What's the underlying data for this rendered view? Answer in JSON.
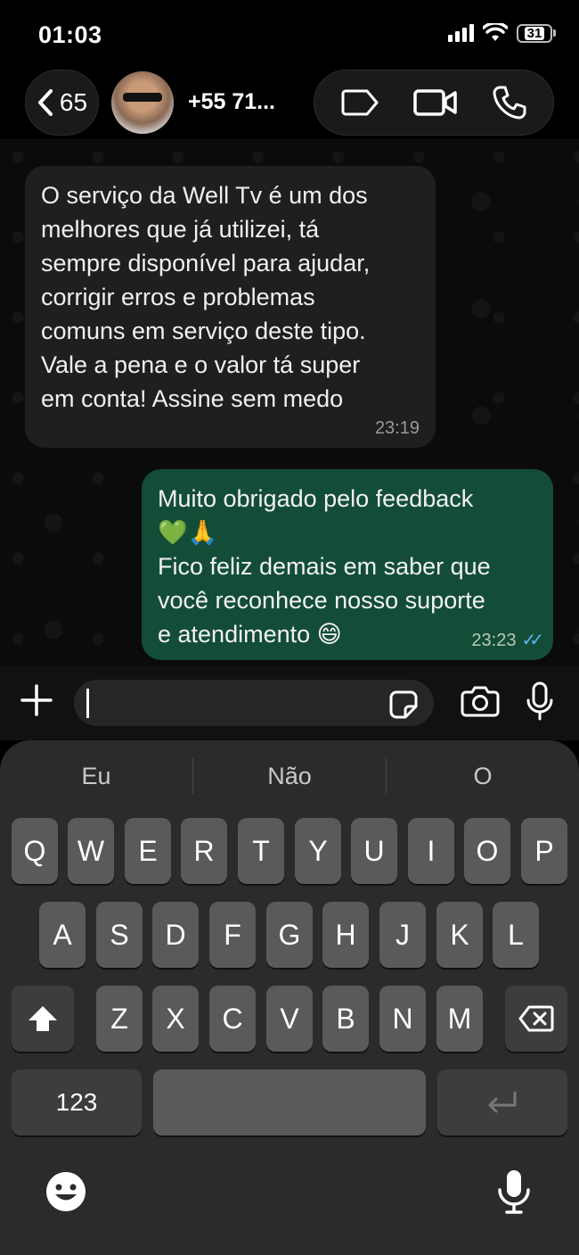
{
  "status": {
    "time": "01:03",
    "battery": "31"
  },
  "header": {
    "back_count": "65",
    "contact_name": "+55 71..."
  },
  "messages": {
    "incoming": {
      "text": "O serviço da Well Tv é um dos\nmelhores que já utilizei, tá\nsempre disponível para ajudar,\ncorrigir erros e problemas\ncomuns em serviço deste tipo.\nVale a pena e o valor tá super\nem conta! Assine sem medo",
      "time": "23:19"
    },
    "outgoing": {
      "text": "Muito obrigado pelo feedback\n💚🙏\nFico feliz demais em saber que\nvocê reconhece nosso suporte\ne atendimento 😄",
      "time": "23:23"
    }
  },
  "keyboard": {
    "suggestions": [
      "Eu",
      "Não",
      "O"
    ],
    "row1": [
      "Q",
      "W",
      "E",
      "R",
      "T",
      "Y",
      "U",
      "I",
      "O",
      "P"
    ],
    "row2": [
      "A",
      "S",
      "D",
      "F",
      "G",
      "H",
      "J",
      "K",
      "L"
    ],
    "row3": [
      "Z",
      "X",
      "C",
      "V",
      "B",
      "N",
      "M"
    ],
    "numbers_label": "123"
  },
  "colors": {
    "outgoing_bubble": "#134d37",
    "incoming_bubble": "#1f1f1f",
    "read_ticks": "#5ab5f5"
  }
}
